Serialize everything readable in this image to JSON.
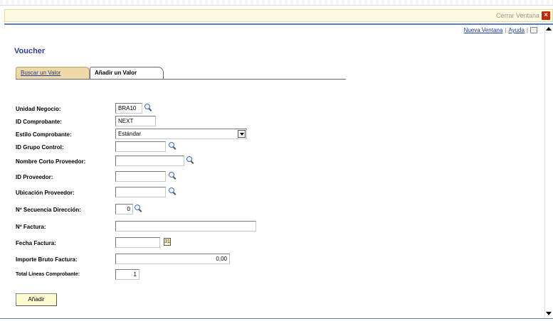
{
  "window": {
    "close_label": "Cerrar Ventana",
    "close_icon": "close-icon"
  },
  "top_links": {
    "new_window": "Nueva Ventana",
    "help": "Ayuda",
    "new_window_icon": "new-window-icon"
  },
  "page_title": "Voucher",
  "tabs": [
    {
      "label": "Buscar un Valor",
      "active": false
    },
    {
      "label": "Añadir un Valor",
      "active": true
    }
  ],
  "form": {
    "unidad_negocio": {
      "label": "Unidad Negocio:",
      "value": "BRA10"
    },
    "id_comprobante": {
      "label": "ID Comprobante:",
      "value": "NEXT"
    },
    "estilo_comprobante": {
      "label": "Estilo Comprobante:",
      "value": "Estándar"
    },
    "id_grupo_control": {
      "label": "ID Grupo Control:",
      "value": ""
    },
    "nombre_corto_proveedor": {
      "label": "Nombre Corto Proveedor:",
      "value": ""
    },
    "id_proveedor": {
      "label": "ID Proveedor:",
      "value": ""
    },
    "ubicacion_proveedor": {
      "label": "Ubicación Proveedor:",
      "value": ""
    },
    "secuencia_direccion": {
      "label": "Nº Secuencia Dirección:",
      "value": "0"
    },
    "n_factura": {
      "label": "Nº Factura:",
      "value": ""
    },
    "fecha_factura": {
      "label": "Fecha Factura:",
      "value": ""
    },
    "importe_bruto": {
      "label": "Importe Bruto Factura:",
      "value": "0,00"
    },
    "total_lineas": {
      "label": "Total Líneas Comprobante:",
      "value": "1"
    }
  },
  "add_button_label": "Añadir",
  "colors": {
    "title_blue": "#2c3ca8",
    "link_blue": "#1a3d9e",
    "tab_inactive_bg": "#efd9a8",
    "header_bg": "#fffbe0",
    "rule_blue": "#5b7fb7"
  }
}
